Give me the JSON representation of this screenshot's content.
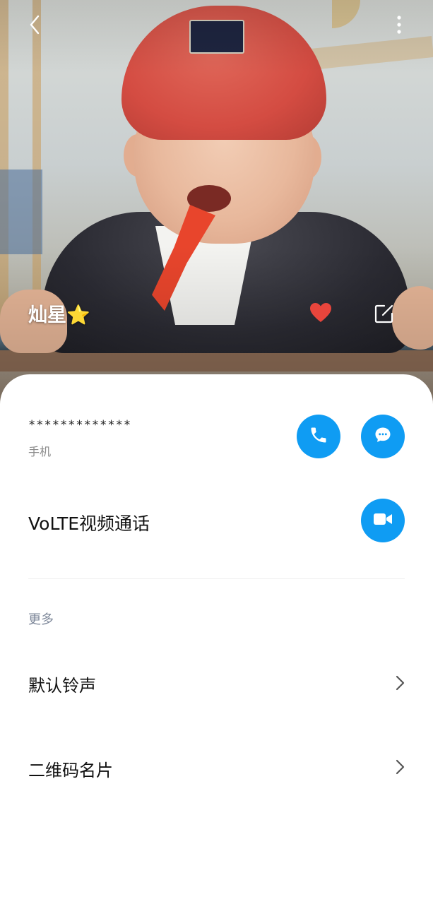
{
  "header": {
    "back_icon": "back-arrow-icon",
    "more_icon": "more-vertical-icon"
  },
  "contact": {
    "name": "灿星⭐",
    "favorite_icon": "heart-icon",
    "favorite_color": "#e8453c",
    "edit_icon": "edit-icon"
  },
  "phone": {
    "number": "*************",
    "label": "手机",
    "call_icon": "phone-icon",
    "message_icon": "message-icon"
  },
  "video_call": {
    "label": "VoLTE视频通话",
    "icon": "video-camera-icon"
  },
  "more_section": {
    "title": "更多",
    "items": [
      {
        "label": "默认铃声",
        "icon": "chevron-right-icon"
      },
      {
        "label": "二维码名片",
        "icon": "chevron-right-icon"
      }
    ]
  },
  "colors": {
    "accent": "#0f9cf3",
    "secondary_text": "#8a8a8a",
    "section_header": "#7d8799"
  }
}
